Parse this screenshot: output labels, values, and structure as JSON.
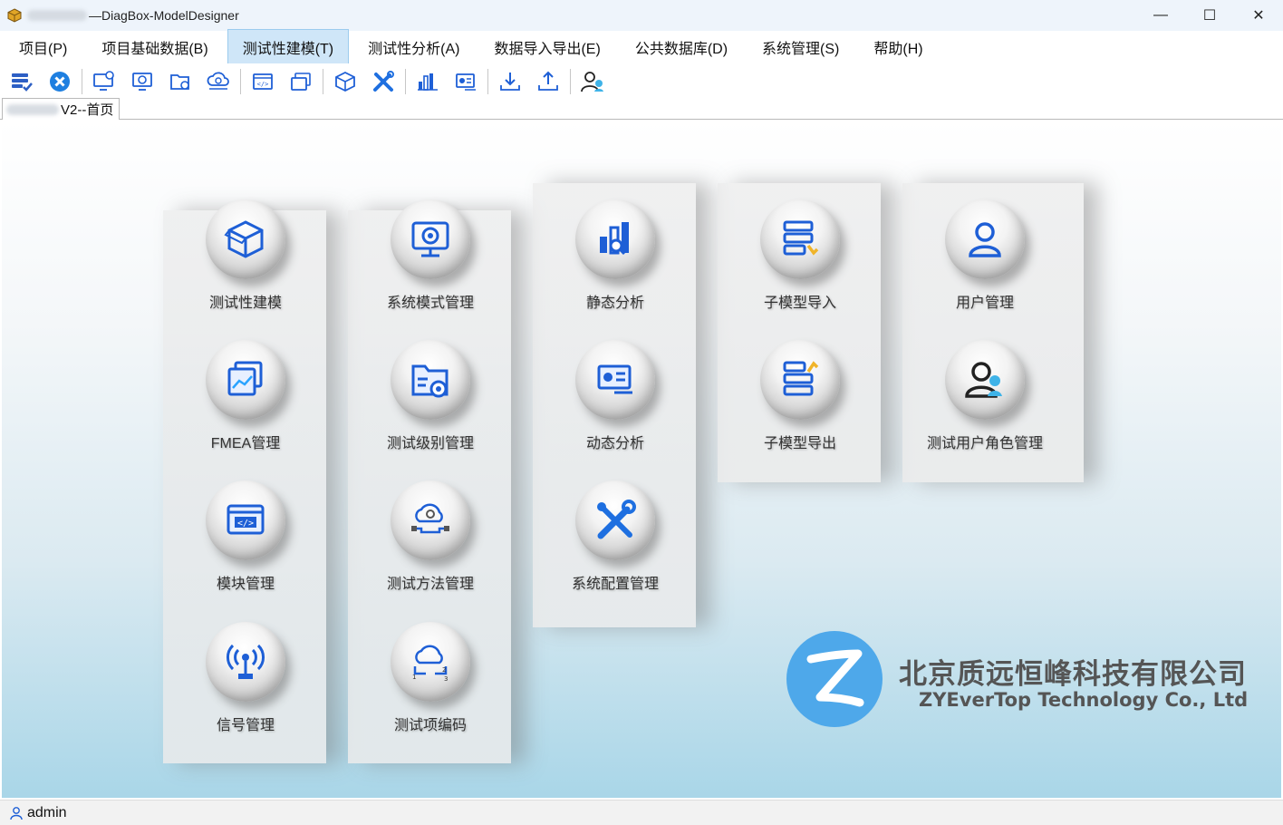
{
  "window": {
    "title": "—DiagBox-ModelDesigner",
    "minimize": "—",
    "maximize": "☐",
    "close": "✕"
  },
  "menu": [
    {
      "label": "项目(P)"
    },
    {
      "label": "项目基础数据(B)"
    },
    {
      "label": "测试性建模(T)",
      "active": true
    },
    {
      "label": "测试性分析(A)"
    },
    {
      "label": "数据导入导出(E)"
    },
    {
      "label": "公共数据库(D)"
    },
    {
      "label": "系统管理(S)"
    },
    {
      "label": "帮助(H)"
    }
  ],
  "toolbar_icons": [
    "layers-check-icon",
    "close-circle-icon",
    "monitor-gear-icon",
    "monitor-chip-icon",
    "folder-gear-icon",
    "cloud-gear-icon",
    "code-window-icon",
    "stacked-windows-icon",
    "cube-icon",
    "tools-icon",
    "bar-chart-icon",
    "dashboard-icon",
    "download-icon",
    "upload-icon",
    "user-manage-icon"
  ],
  "tab": {
    "label": "V2--首页"
  },
  "tiles": {
    "col1": [
      {
        "label": "测试性建模",
        "icon": "cube-icon"
      },
      {
        "label": "FMEA管理",
        "icon": "chart-window-icon"
      },
      {
        "label": "模块管理",
        "icon": "code-window-icon"
      },
      {
        "label": "信号管理",
        "icon": "antenna-icon"
      }
    ],
    "col2": [
      {
        "label": "系统模式管理",
        "icon": "monitor-icon"
      },
      {
        "label": "测试级别管理",
        "icon": "folder-gear-icon"
      },
      {
        "label": "测试方法管理",
        "icon": "cloud-network-icon"
      },
      {
        "label": "测试项编码",
        "icon": "cloud-code-icon"
      }
    ],
    "col3": [
      {
        "label": "静态分析",
        "icon": "bar-chart-icon"
      },
      {
        "label": "动态分析",
        "icon": "dashboard-icon"
      },
      {
        "label": "系统配置管理",
        "icon": "tools-icon"
      }
    ],
    "col4": [
      {
        "label": "子模型导入",
        "icon": "server-import-icon"
      },
      {
        "label": "子模型导出",
        "icon": "server-export-icon"
      }
    ],
    "col5": [
      {
        "label": "用户管理",
        "icon": "user-icon"
      },
      {
        "label": "测试用户角色管理",
        "icon": "user-role-icon"
      }
    ]
  },
  "logo": {
    "cn": "北京质远恒峰科技有限公司",
    "en": "ZYEverTop Technology Co., Ltd"
  },
  "status": {
    "user": "admin"
  },
  "colors": {
    "accent": "#1e5fd6",
    "menu_active": "#cfe6f8",
    "logo": "#4ea8ea"
  }
}
